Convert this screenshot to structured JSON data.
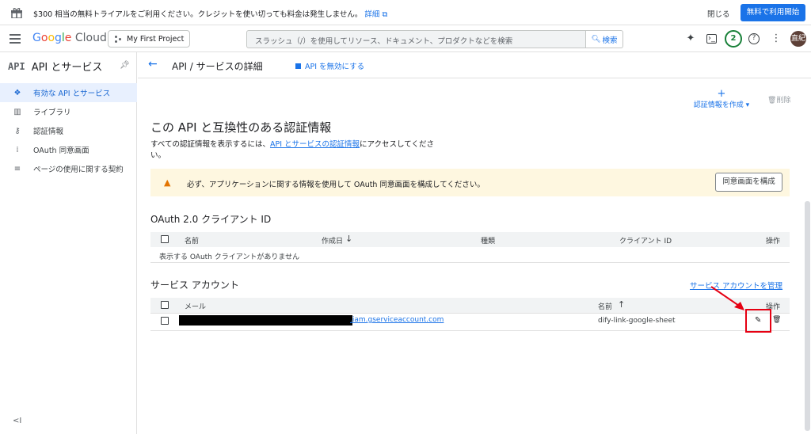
{
  "banner": {
    "message": "$300 相当の無料トライアルをご利用ください。クレジットを使い切っても料金は発生しません。",
    "details_link": "詳細",
    "close_label": "閉じる",
    "trial_button": "無料で利用開始"
  },
  "topbar": {
    "logo_google": "Google",
    "logo_cloud": "Cloud",
    "project": "My First Project",
    "search_placeholder": "スラッシュ（/）を使用してリソース、ドキュメント、プロダクトなどを検索",
    "search_button": "検索",
    "notification_count": "2",
    "avatar_text": "直紀"
  },
  "sidebar": {
    "icon_text": "API",
    "title": "API とサービス",
    "items": [
      {
        "label": "有効な API とサービス",
        "icon": "diamond-icon",
        "active": true
      },
      {
        "label": "ライブラリ",
        "icon": "library-icon",
        "active": false
      },
      {
        "label": "認証情報",
        "icon": "key-icon",
        "active": false
      },
      {
        "label": "OAuth 同意画面",
        "icon": "consent-icon",
        "active": false
      },
      {
        "label": "ページの使用に関する契約",
        "icon": "settings-list-icon",
        "active": false
      }
    ],
    "collapse_icon": "<I"
  },
  "main": {
    "page_title": "API / サービスの詳細",
    "disable_api": "API を無効にする",
    "create_credentials": "認証情報を作成",
    "delete_label": "削除",
    "compat_heading": "この API と互換性のある認証情報",
    "desc_before": "すべての認証情報を表示するには、",
    "desc_link": "API とサービスの認証情報",
    "desc_after": "にアクセスしてください。",
    "warning_text": "必ず、アプリケーションに関する情報を使用して OAuth 同意画面を構成してください。",
    "warning_button": "同意画面を構成",
    "oauth": {
      "heading": "OAuth 2.0 クライアント ID",
      "columns": [
        "名前",
        "作成日",
        "種類",
        "クライアント ID",
        "操作"
      ],
      "empty_message": "表示する OAuth クライアントがありません"
    },
    "service_accounts": {
      "heading": "サービス アカウント",
      "manage_link": "サービス アカウントを管理",
      "columns": [
        "メール",
        "名前",
        "操作"
      ],
      "rows": [
        {
          "email_suffix": ".iam.gserviceaccount.com",
          "name": "dify-link-google-sheet"
        }
      ]
    }
  },
  "colors": {
    "accent": "#1a73e8",
    "warning_bg": "#fef7e0",
    "highlight": "#e60012"
  }
}
